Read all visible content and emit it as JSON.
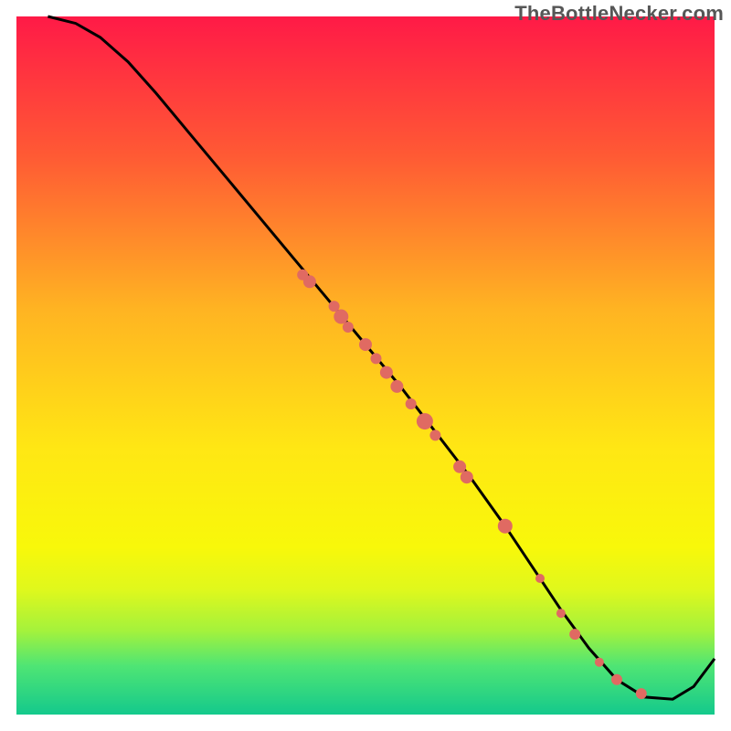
{
  "watermark": "TheBottleNecker.com",
  "chart_data": {
    "type": "line",
    "title": "",
    "xlabel": "",
    "ylabel": "",
    "xlim": [
      0,
      100
    ],
    "ylim": [
      0,
      100
    ],
    "grid": false,
    "background": {
      "gradient_stops": [
        {
          "pos": 0.0,
          "color": "#ff1a47"
        },
        {
          "pos": 0.2,
          "color": "#ff5a34"
        },
        {
          "pos": 0.42,
          "color": "#ffb422"
        },
        {
          "pos": 0.62,
          "color": "#ffe714"
        },
        {
          "pos": 0.76,
          "color": "#f8f80a"
        },
        {
          "pos": 0.82,
          "color": "#e0f81c"
        },
        {
          "pos": 0.88,
          "color": "#a4f23c"
        },
        {
          "pos": 0.93,
          "color": "#4fe574"
        },
        {
          "pos": 1.0,
          "color": "#14c98c"
        }
      ]
    },
    "series": [
      {
        "name": "curve",
        "stroke": "#000000",
        "x": [
          4.5,
          8.5,
          12.0,
          16.0,
          20.0,
          25.0,
          30.0,
          35.0,
          40.0,
          45.0,
          50.0,
          55.0,
          60.0,
          65.0,
          70.0,
          74.0,
          78.0,
          82.0,
          86.0,
          90.0,
          94.0,
          97.0,
          100.0
        ],
        "y": [
          100.0,
          99.0,
          97.0,
          93.5,
          89.0,
          83.0,
          77.0,
          71.0,
          65.0,
          59.0,
          53.0,
          47.0,
          40.5,
          34.0,
          27.0,
          21.0,
          15.0,
          9.5,
          5.0,
          2.5,
          2.2,
          4.0,
          8.0
        ]
      }
    ],
    "markers": {
      "name": "dots",
      "color": "#e06a62",
      "points": [
        {
          "x": 41.0,
          "y": 63.0,
          "r": 6
        },
        {
          "x": 42.0,
          "y": 62.0,
          "r": 7
        },
        {
          "x": 45.5,
          "y": 58.5,
          "r": 6
        },
        {
          "x": 46.5,
          "y": 57.0,
          "r": 8
        },
        {
          "x": 47.5,
          "y": 55.5,
          "r": 6
        },
        {
          "x": 50.0,
          "y": 53.0,
          "r": 7
        },
        {
          "x": 51.5,
          "y": 51.0,
          "r": 6
        },
        {
          "x": 53.0,
          "y": 49.0,
          "r": 7
        },
        {
          "x": 54.5,
          "y": 47.0,
          "r": 7
        },
        {
          "x": 56.5,
          "y": 44.5,
          "r": 6
        },
        {
          "x": 58.5,
          "y": 42.0,
          "r": 9
        },
        {
          "x": 60.0,
          "y": 40.0,
          "r": 6
        },
        {
          "x": 63.5,
          "y": 35.5,
          "r": 7
        },
        {
          "x": 64.5,
          "y": 34.0,
          "r": 7
        },
        {
          "x": 70.0,
          "y": 27.0,
          "r": 8
        },
        {
          "x": 75.0,
          "y": 19.5,
          "r": 5
        },
        {
          "x": 78.0,
          "y": 14.5,
          "r": 5
        },
        {
          "x": 80.0,
          "y": 11.5,
          "r": 6
        },
        {
          "x": 83.5,
          "y": 7.5,
          "r": 5
        },
        {
          "x": 86.0,
          "y": 5.0,
          "r": 6
        },
        {
          "x": 89.5,
          "y": 3.0,
          "r": 6
        }
      ]
    }
  }
}
